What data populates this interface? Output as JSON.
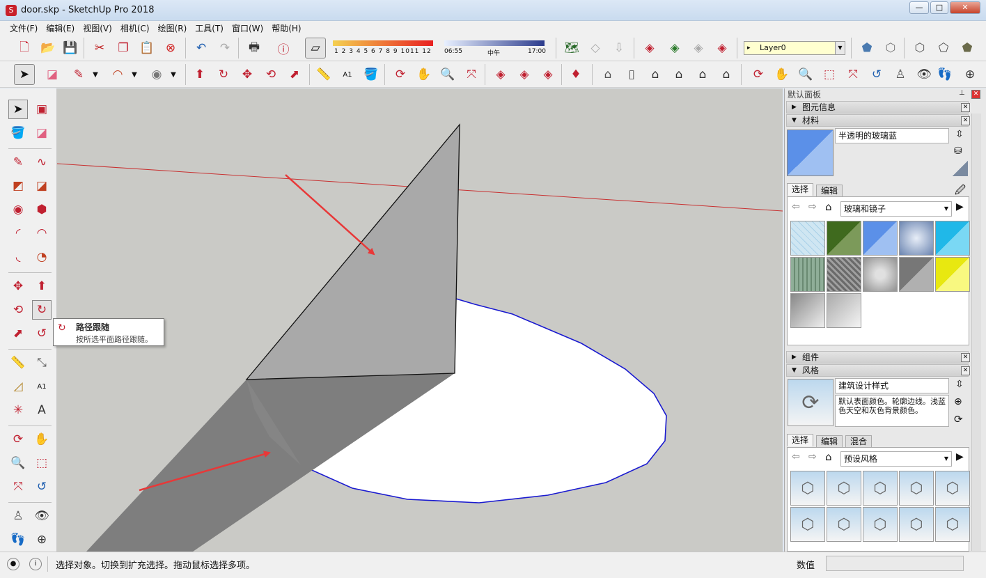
{
  "window": {
    "title": "door.skp - SketchUp Pro 2018",
    "minimize": "—",
    "maximize": "□",
    "close": "✕"
  },
  "menu": [
    "文件(F)",
    "编辑(E)",
    "视图(V)",
    "相机(C)",
    "绘图(R)",
    "工具(T)",
    "窗口(W)",
    "帮助(H)"
  ],
  "shadow": {
    "months": [
      "1",
      "2",
      "3",
      "4",
      "5",
      "6",
      "7",
      "8",
      "9",
      "10",
      "11",
      "12"
    ],
    "time_start": "06:55",
    "time_mid": "中午",
    "time_end": "17:00"
  },
  "layer": {
    "current": "Layer0"
  },
  "tooltip": {
    "title": "路径跟随",
    "desc": "按所选平面路径跟随。"
  },
  "panel": {
    "title": "默认面板",
    "entity_info": "图元信息",
    "materials": {
      "header": "材料",
      "current_name": "半透明的玻璃蓝",
      "tab_select": "选择",
      "tab_edit": "编辑",
      "library": "玻璃和镜子",
      "swatches": [
        "#cfe6f2",
        "#4b6b2e",
        "#7aa0ec",
        "#9ab0cc",
        "#33c2ee",
        "#8fae98",
        "#8a8a8a",
        "#c8c8c8",
        "#8a8a8a",
        "#f2f220",
        "#b8b8b8",
        "#d0d0d0"
      ]
    },
    "components": "组件",
    "styles": {
      "header": "风格",
      "name": "建筑设计样式",
      "desc": "默认表面颜色。轮廓边线。浅蓝色天空和灰色背景颜色。",
      "tab_select": "选择",
      "tab_edit": "编辑",
      "tab_mix": "混合",
      "library": "预设风格"
    }
  },
  "status": {
    "message": "选择对象。切换到扩充选择。拖动鼠标选择多项。",
    "measure_label": "数值",
    "measure_value": ""
  }
}
